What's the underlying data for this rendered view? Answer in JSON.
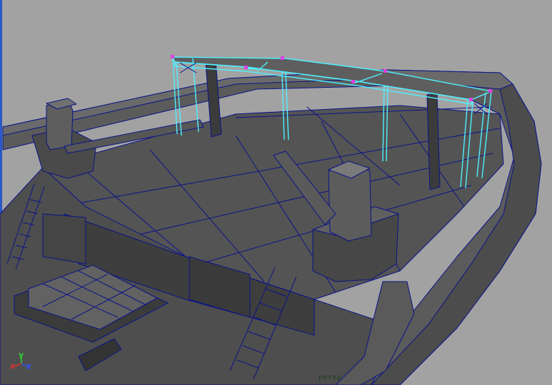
{
  "viewport": {
    "camera_label": "persp",
    "background_color": "#a2a2a2",
    "wireframe_color": "#000c8c",
    "selection_color": "#4ff0ff",
    "vertex_color": "#e040e0"
  },
  "axis_gizmo": {
    "x_label": "x",
    "y_label": "y",
    "z_label": "z",
    "x_color": "#e03030",
    "y_color": "#30d030",
    "z_color": "#3050ff"
  }
}
